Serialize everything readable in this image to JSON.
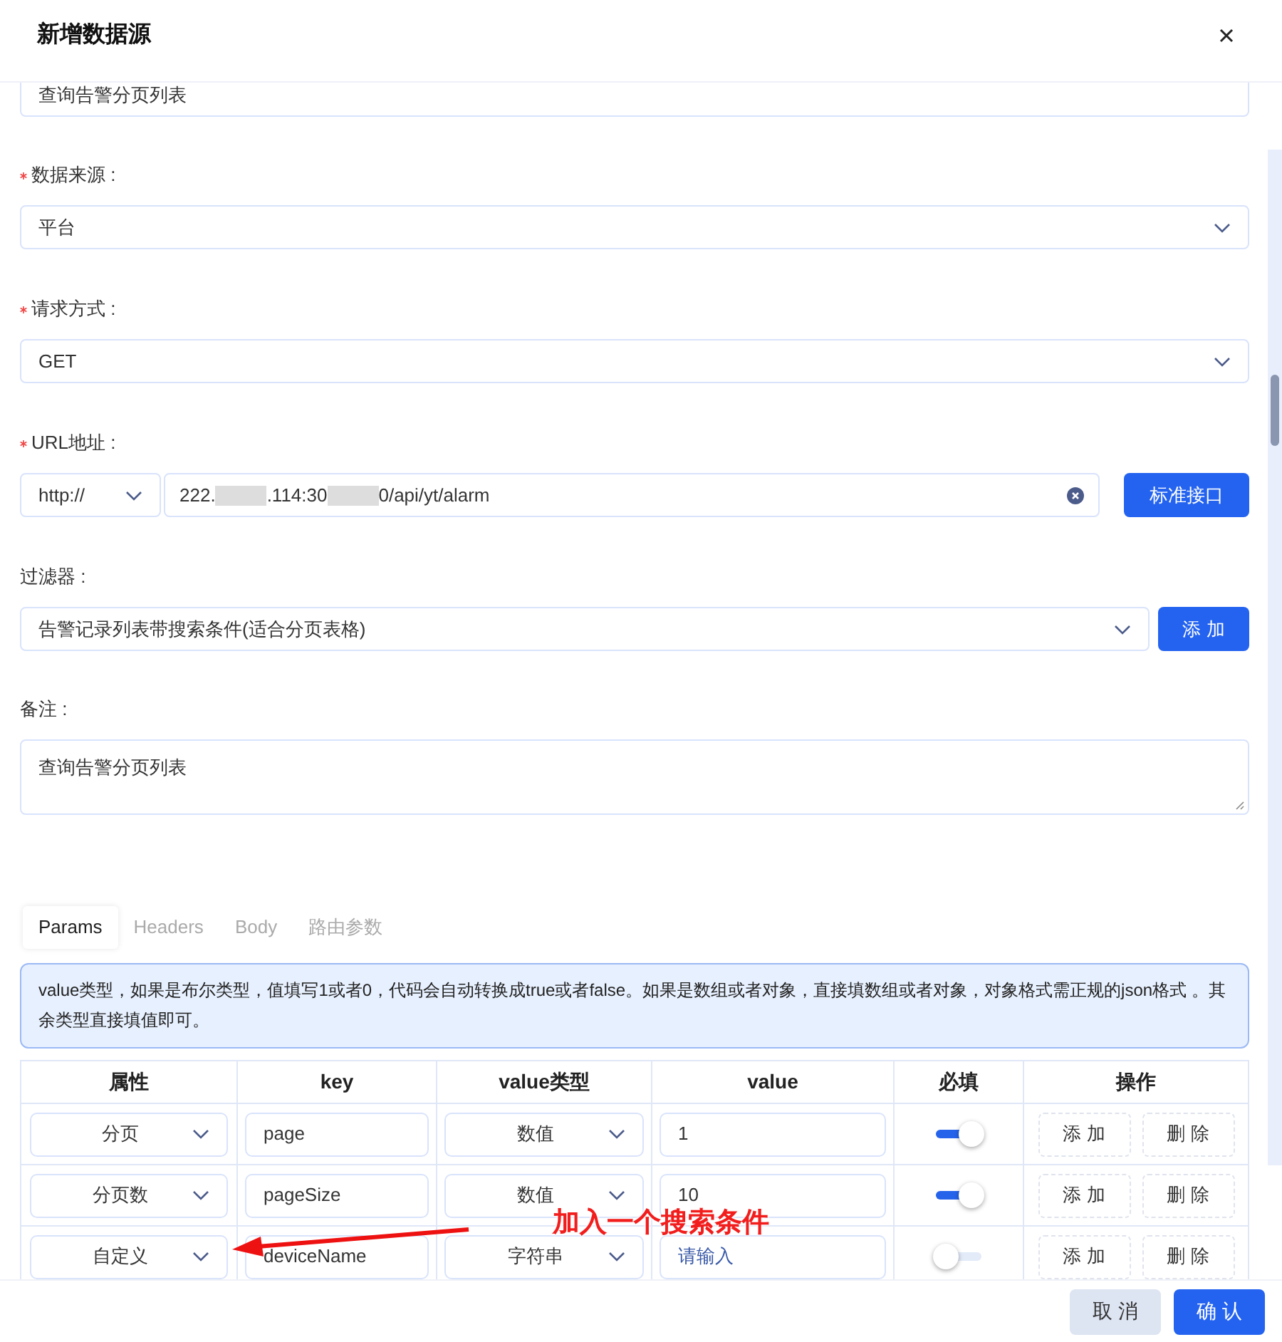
{
  "dialog": {
    "title": "新增数据源"
  },
  "name_field": {
    "value": "查询告警分页列表"
  },
  "source": {
    "label": "数据来源 :",
    "required": true,
    "value": "平台"
  },
  "method": {
    "label": "请求方式 :",
    "required": true,
    "value": "GET"
  },
  "url": {
    "label": "URL地址 :",
    "required": true,
    "protocol": "http://",
    "parts": [
      {
        "kind": "text",
        "text": "222."
      },
      {
        "kind": "redacted"
      },
      {
        "kind": "text",
        "text": ".114:30"
      },
      {
        "kind": "redacted"
      },
      {
        "kind": "text",
        "text": "0/api/yt/alarm"
      }
    ],
    "button": "标准接口"
  },
  "filter": {
    "label": "过滤器 :",
    "required": false,
    "value": "告警记录列表带搜索条件(适合分页表格)",
    "button": "添 加"
  },
  "remark": {
    "label": "备注 :",
    "required": false,
    "value": "查询告警分页列表"
  },
  "tabs": [
    {
      "label": "Params",
      "selected": true
    },
    {
      "label": "Headers",
      "selected": false
    },
    {
      "label": "Body",
      "selected": false
    },
    {
      "label": "路由参数",
      "selected": false
    }
  ],
  "notice": "value类型，如果是布尔类型，值填写1或者0，代码会自动转换成true或者false。如果是数组或者对象，直接填数组或者对象，对象格式需正规的json格式 。其余类型直接填值即可。",
  "table": {
    "columns": [
      "属性",
      "key",
      "value类型",
      "value",
      "必填",
      "操作"
    ],
    "rows": [
      {
        "attribute": "分页",
        "key": "page",
        "value_type": "数值",
        "value": "1",
        "required": true,
        "actions": [
          "添 加",
          "删 除"
        ]
      },
      {
        "attribute": "分页数",
        "key": "pageSize",
        "value_type": "数值",
        "value": "10",
        "required": true,
        "actions": [
          "添 加",
          "删 除"
        ]
      },
      {
        "attribute": "自定义",
        "key": "deviceName",
        "value_type": "字符串",
        "placeholder": "请输入",
        "required": false,
        "actions": [
          "添 加",
          "删 除"
        ]
      }
    ]
  },
  "annotation": {
    "text": "加入一个搜索条件"
  },
  "footer": {
    "buttons": [
      {
        "label": "取 消",
        "kind": "secondary"
      },
      {
        "label": "确 认",
        "kind": "primary"
      }
    ]
  }
}
